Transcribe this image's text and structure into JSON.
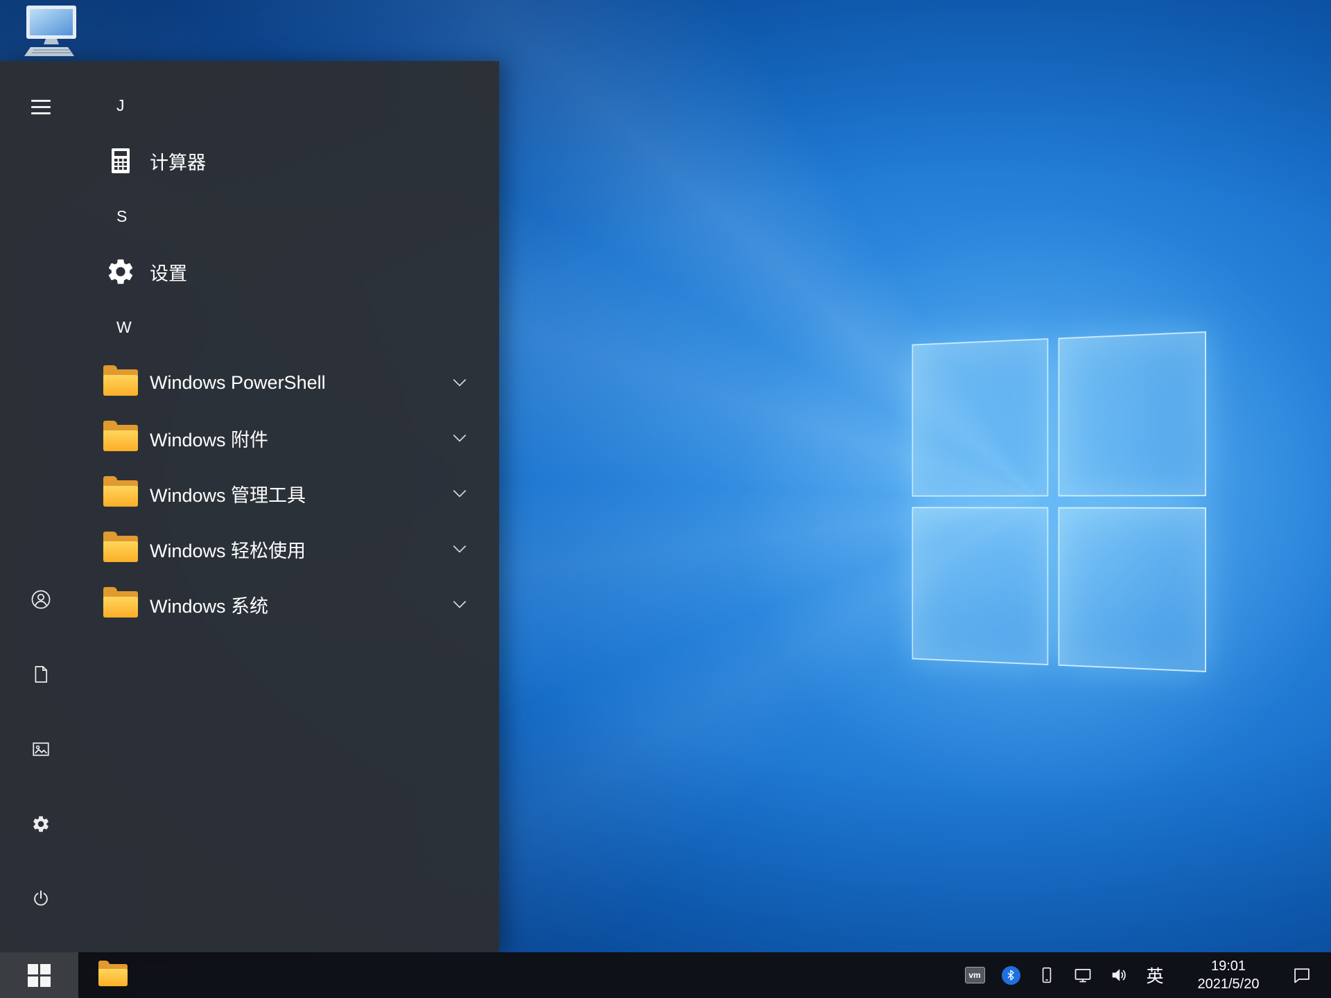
{
  "desktop": {
    "icons": [
      {
        "name": "this-pc",
        "icon": "computer-icon"
      }
    ],
    "wallpaper": {
      "base_color": "#156bc6",
      "logo_color": "#a8e0ff"
    }
  },
  "start_menu": {
    "rows": [
      {
        "type": "header",
        "label": "J"
      },
      {
        "type": "app",
        "icon": "calculator-icon",
        "label": "计算器"
      },
      {
        "type": "header",
        "label": "S"
      },
      {
        "type": "app",
        "icon": "settings-gear-icon",
        "label": "设置"
      },
      {
        "type": "header",
        "label": "W"
      },
      {
        "type": "group",
        "icon": "folder-icon",
        "label": "Windows PowerShell",
        "chevron": "chevron-down-icon"
      },
      {
        "type": "group",
        "icon": "folder-icon",
        "label": "Windows 附件",
        "chevron": "chevron-down-icon"
      },
      {
        "type": "group",
        "icon": "folder-icon",
        "label": "Windows 管理工具",
        "chevron": "chevron-down-icon"
      },
      {
        "type": "group",
        "icon": "folder-icon",
        "label": "Windows 轻松使用",
        "chevron": "chevron-down-icon"
      },
      {
        "type": "group",
        "icon": "folder-icon",
        "label": "Windows 系统",
        "chevron": "chevron-down-icon"
      }
    ],
    "rail": {
      "top": [
        {
          "name": "expand",
          "icon": "hamburger-icon"
        }
      ],
      "bottom": [
        {
          "name": "user",
          "icon": "user-icon"
        },
        {
          "name": "documents",
          "icon": "document-icon"
        },
        {
          "name": "pictures",
          "icon": "pictures-icon"
        },
        {
          "name": "settings",
          "icon": "gear-icon"
        },
        {
          "name": "power",
          "icon": "power-icon"
        }
      ]
    }
  },
  "taskbar": {
    "start": {
      "icon": "windows-logo-icon",
      "state": "open"
    },
    "pinned": [
      {
        "name": "file-explorer",
        "icon": "folder-icon"
      }
    ],
    "tray": {
      "vmware_label": "vm",
      "bluetooth": {
        "icon": "bluetooth-icon",
        "color": "#1f6fe0"
      },
      "device_icon": "tablet-icon",
      "network_icon": "network-icon",
      "volume_icon": "volume-icon",
      "ime_label": "英",
      "clock": {
        "time": "19:01",
        "date": "2021/5/20"
      },
      "action_center_icon": "action-center-icon"
    }
  },
  "colors": {
    "menu_bg": "#2c3035",
    "taskbar_bg": "#0e1014",
    "folder_yellow": "#ffd65c",
    "accent_blue": "#1f6fe0"
  }
}
